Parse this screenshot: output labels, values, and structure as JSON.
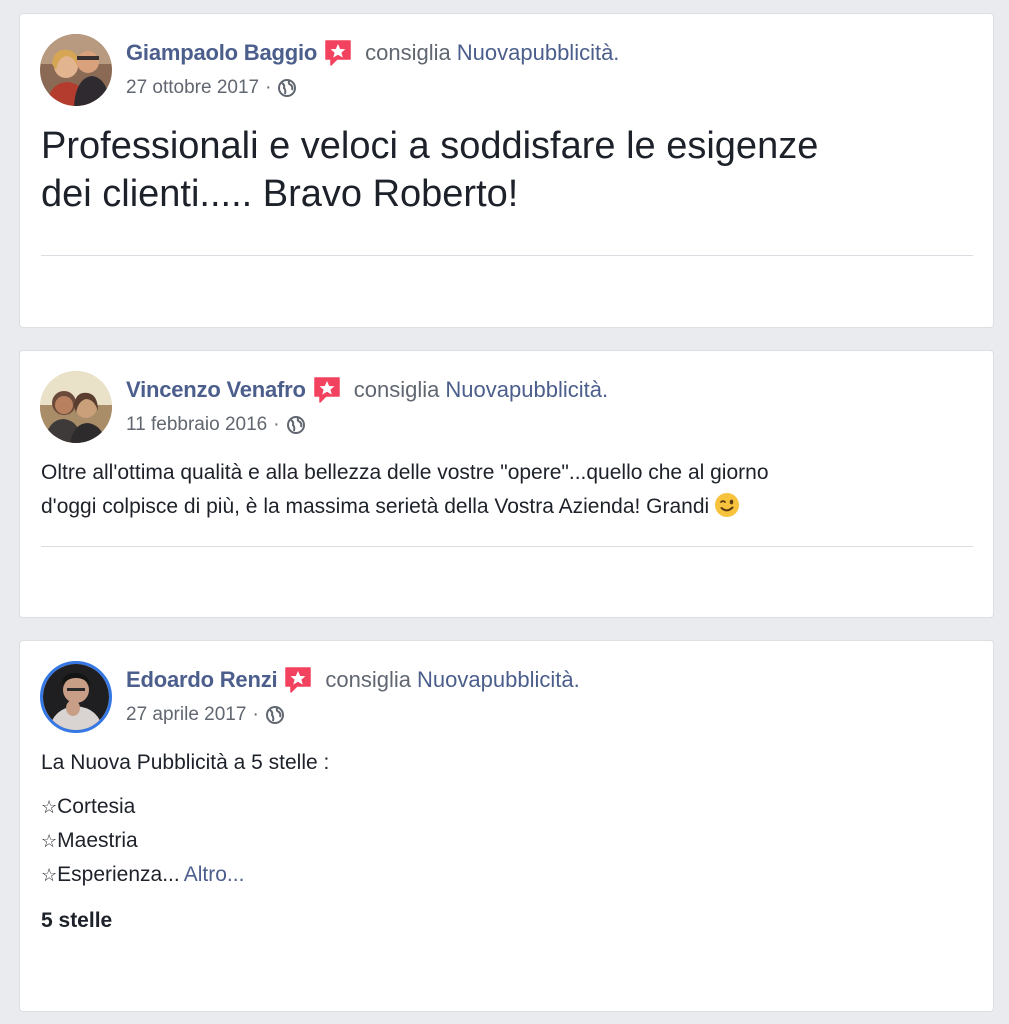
{
  "posts": [
    {
      "author": "Giampaolo Baggio",
      "verb": "consiglia",
      "page": "Nuovapubblicità.",
      "date": "27 ottobre 2017",
      "separator": "·",
      "text_line1": "Professionali e veloci a soddisfare le esigenze",
      "text_line2": "dei clienti..... Bravo Roberto!"
    },
    {
      "author": "Vincenzo Venafro",
      "verb": "consiglia",
      "page": "Nuovapubblicità.",
      "date": "11 febbraio 2016",
      "separator": "·",
      "text_line1": "Oltre all'ottima qualità e alla bellezza delle vostre \"opere\"...quello che al giorno",
      "text_line2": "d'oggi colpisce di più, è la massima serietà della Vostra Azienda! Grandi"
    },
    {
      "author": "Edoardo Renzi",
      "verb": "consiglia",
      "page": "Nuovapubblicità.",
      "date": "27 aprile 2017",
      "separator": "·",
      "intro": "La Nuova Pubblicità a 5 stelle :",
      "star_glyph": "☆",
      "items": [
        "Cortesia",
        "Maestria",
        "Esperienza..."
      ],
      "more_label": "Altro...",
      "rating": "5 stelle"
    }
  ],
  "colors": {
    "background": "#e9ebee",
    "link": "#4b5e8c",
    "badge": "#f3425f",
    "muted": "#606770"
  },
  "icons": {
    "badge": "recommend-badge-icon",
    "privacy": "globe-icon",
    "emoji": "wink-emoji-icon"
  }
}
